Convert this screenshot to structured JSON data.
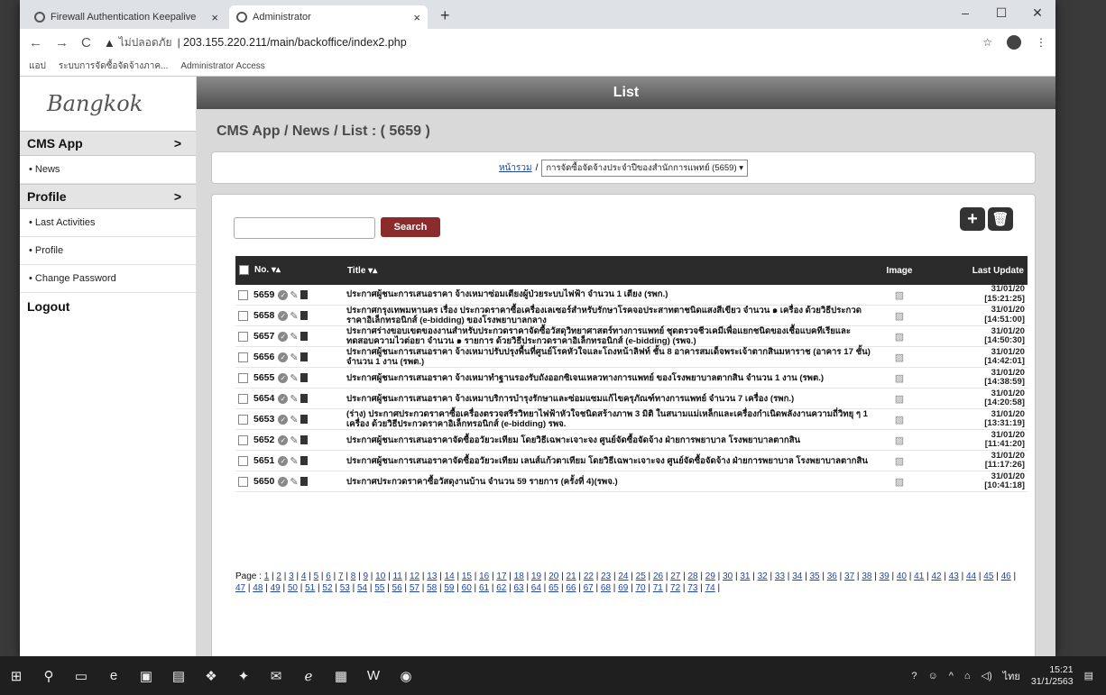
{
  "browser": {
    "tabs": [
      {
        "title": "Firewall Authentication Keepalive",
        "close": "×"
      },
      {
        "title": "Administrator",
        "close": "×"
      }
    ],
    "new_tab": "+",
    "window_controls": [
      "–",
      "☐",
      "✕"
    ],
    "not_secure": "ไม่ปลอดภัย",
    "url": "203.155.220.211/main/backoffice/index2.php",
    "bookmarks": [
      "แอป",
      "ระบบการจัดซื้อจัดจ้างภาค...",
      "Administrator Access"
    ]
  },
  "sidebar": {
    "brand": "Bangkok",
    "cms_app": "CMS App",
    "news": "• News",
    "profile": "Profile",
    "items": [
      "• Last Activities",
      "• Profile",
      "• Change Password"
    ],
    "logout": "Logout",
    "chevron": ">"
  },
  "main": {
    "header": "List",
    "breadcrumb": "CMS App / News / List : ( 5659 )",
    "filter_link": "หน้ารวม",
    "filter_sep": "/",
    "filter_select": "การจัดซื้อจัดจ้างประจำปีของสำนักการแพทย์ (5659) ▾",
    "search_label": "Search",
    "add_icon": "+",
    "delete_icon": "🗑",
    "columns": {
      "no": "No.",
      "title": "Title",
      "image": "Image",
      "last_update": "Last Update"
    },
    "rows": [
      {
        "no": "5659",
        "title": "ประกาศผู้ชนะการเสนอราคา จ้างเหมาซ่อมเตียงผู้ป่วยระบบไฟฟ้า จำนวน 1 เตียง (รพก.)",
        "date": "31/01/20",
        "time": "[15:21:25]"
      },
      {
        "no": "5658",
        "title": "ประกาศกรุงเทพมหานคร เรื่อง ประกวดราคาซื้อเครื่องเลเซอร์สำหรับรักษาโรคจอประสาทตาชนิดแสงสีเขียว จำนวน ๑ เครื่อง ด้วยวิธีประกวดราคาอิเล็กทรอนิกส์ (e-bidding) ของโรงพยาบาลกลาง",
        "date": "31/01/20",
        "time": "[14:51:00]"
      },
      {
        "no": "5657",
        "title": "ประกาศร่างขอบเขตของงานสำหรับประกวดราคาจัดซื้อวัสดุวิทยาศาสตร์ทางการแพทย์ ชุดตรวจชีวเคมีเพื่อแยกชนิดของเชื้อแบคทีเรียและทดสอบความไวต่อยา จำนวน ๑ รายการ ด้วยวิธีประกวดราคาอิเล็กทรอนิกส์ (e-bidding) (รพจ.)",
        "date": "31/01/20",
        "time": "[14:50:30]"
      },
      {
        "no": "5656",
        "title": "ประกาศผู้ชนะการเสนอราคา จ้างเหมาปรับปรุงพื้นที่ศูนย์โรคหัวใจและโถงหน้าลิฟท์ ชั้น 8 อาคารสมเด็จพระเจ้าตากสินมหาราช (อาคาร 17 ชั้น) จำนวน 1 งาน (รพต.)",
        "date": "31/01/20",
        "time": "[14:42:01]"
      },
      {
        "no": "5655",
        "title": "ประกาศผู้ชนะการเสนอราคา จ้างเหมาทำฐานรองรับถังออกซิเจนเหลวทางการแพทย์ ของโรงพยาบาลตากสิน จำนวน 1 งาน (รพต.)",
        "date": "31/01/20",
        "time": "[14:38:59]"
      },
      {
        "no": "5654",
        "title": "ประกาศผู้ชนะการเสนอราคา จ้างเหมาบริการบำรุงรักษาและซ่อมแซมแก้ไขครุภัณฑ์ทางการแพทย์ จำนวน 7 เครื่อง (รพก.)",
        "date": "31/01/20",
        "time": "[14:20:58]"
      },
      {
        "no": "5653",
        "title": "(ร่าง) ประกาศประกวดราคาซื้อเครื่องตรวจสรีรวิทยาไฟฟ้าหัวใจชนิดสร้างภาพ 3 มิติ ในสนามแม่เหล็กและเครื่องกำเนิดพลังงานความถี่วิทยุ ๆ 1 เครื่อง ด้วยวิธีประกวดราคาอิเล็กทรอนิกส์ (e-bidding) รพจ.",
        "date": "31/01/20",
        "time": "[13:31:19]"
      },
      {
        "no": "5652",
        "title": "ประกาศผู้ชนะการเสนอราคาจัดซื้ออวัยวะเทียม โดยวิธีเฉพาะเจาะจง ศูนย์จัดซื้อจัดจ้าง ฝ่ายการพยาบาล โรงพยาบาลตากสิน",
        "date": "31/01/20",
        "time": "[11:41:20]"
      },
      {
        "no": "5651",
        "title": "ประกาศผู้ชนะการเสนอราคาจัดซื้ออวัยวะเทียม เลนส์แก้วตาเทียม โดยวิธีเฉพาะเจาะจง ศูนย์จัดซื้อจัดจ้าง ฝ่ายการพยาบาล โรงพยาบาลตากสิน",
        "date": "31/01/20",
        "time": "[11:17:26]"
      },
      {
        "no": "5650",
        "title": "ประกาศประกวดราคาซื้อวัสดุงานบ้าน จำนวน 59 รายการ (ครั้งที่ 4)(รพจ.)",
        "date": "31/01/20",
        "time": "[10:41:18]"
      }
    ],
    "pager_label": "Page :",
    "pages": [
      "1",
      "2",
      "3",
      "4",
      "5",
      "6",
      "7",
      "8",
      "9",
      "10",
      "11",
      "12",
      "13",
      "14",
      "15",
      "16",
      "17",
      "18",
      "19",
      "20",
      "21",
      "22",
      "23",
      "24",
      "25",
      "26",
      "27",
      "28",
      "29",
      "30",
      "31",
      "32",
      "33",
      "34",
      "35",
      "36",
      "37",
      "38",
      "39",
      "40",
      "41",
      "42",
      "43",
      "44",
      "45",
      "46",
      "47",
      "48",
      "49",
      "50",
      "51",
      "52",
      "53",
      "54",
      "55",
      "56",
      "57",
      "58",
      "59",
      "60",
      "61",
      "62",
      "63",
      "64",
      "65",
      "66",
      "67",
      "68",
      "69",
      "70",
      "71",
      "72",
      "73",
      "74"
    ]
  },
  "taskbar": {
    "ime": "ไทย",
    "time": "15:21",
    "date": "31/1/2563"
  }
}
